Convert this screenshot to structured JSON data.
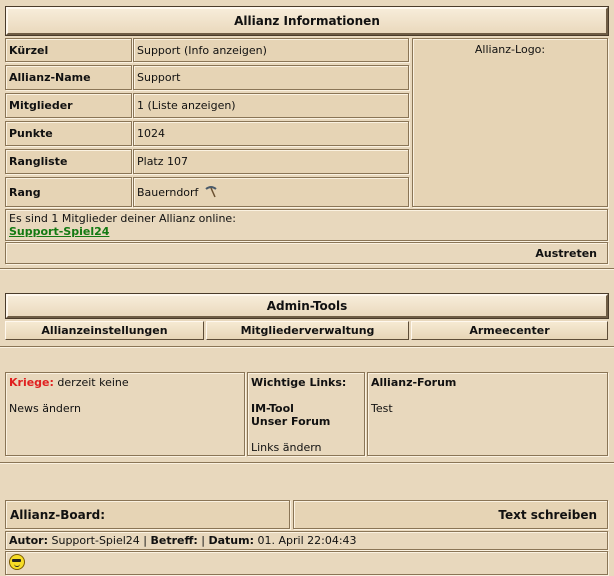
{
  "info": {
    "title": "Allianz Informationen",
    "rows": [
      {
        "label": "Kürzel",
        "value": "Support (Info anzeigen)"
      },
      {
        "label": "Allianz-Name",
        "value": "Support"
      },
      {
        "label": "Mitglieder",
        "value": "1 (Liste anzeigen)"
      },
      {
        "label": "Punkte",
        "value": "1024"
      },
      {
        "label": "Rangliste",
        "value": "Platz 107"
      },
      {
        "label": "Rang",
        "value": "Bauerndorf"
      }
    ],
    "logo_label": "Allianz-Logo:",
    "online_text": "Es sind 1 Mitglieder deiner Allianz online:",
    "online_user": "Support-Spiel24",
    "leave_button": "Austreten"
  },
  "admin": {
    "title": "Admin-Tools",
    "buttons": [
      "Allianzeinstellungen",
      "Mitgliederverwaltung",
      "Armeecenter"
    ]
  },
  "panel": {
    "wars_label": "Kriege:",
    "wars_value": "derzeit keine",
    "news_edit": "News ändern",
    "links_title": "Wichtige Links:",
    "links": [
      "IM-Tool",
      "Unser Forum"
    ],
    "links_edit": "Links ändern",
    "forum_title": "Allianz-Forum",
    "forum_text": "Test"
  },
  "board": {
    "title": "Allianz-Board:",
    "write_button": "Text schreiben",
    "post": {
      "author_label": "Autor:",
      "author": "Support-Spiel24",
      "subject_label": "Betreff:",
      "date_label": "Datum:",
      "date": "01. April 22:04:43"
    }
  }
}
